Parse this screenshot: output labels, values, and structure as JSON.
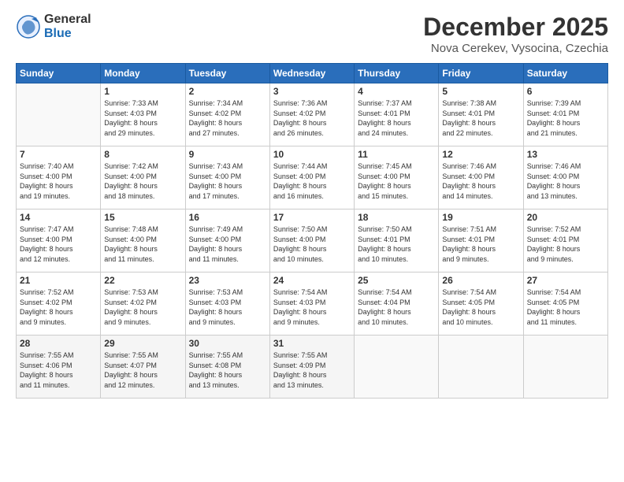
{
  "logo": {
    "general": "General",
    "blue": "Blue"
  },
  "title": "December 2025",
  "location": "Nova Cerekev, Vysocina, Czechia",
  "days_header": [
    "Sunday",
    "Monday",
    "Tuesday",
    "Wednesday",
    "Thursday",
    "Friday",
    "Saturday"
  ],
  "weeks": [
    [
      {
        "day": "",
        "info": ""
      },
      {
        "day": "1",
        "info": "Sunrise: 7:33 AM\nSunset: 4:03 PM\nDaylight: 8 hours\nand 29 minutes."
      },
      {
        "day": "2",
        "info": "Sunrise: 7:34 AM\nSunset: 4:02 PM\nDaylight: 8 hours\nand 27 minutes."
      },
      {
        "day": "3",
        "info": "Sunrise: 7:36 AM\nSunset: 4:02 PM\nDaylight: 8 hours\nand 26 minutes."
      },
      {
        "day": "4",
        "info": "Sunrise: 7:37 AM\nSunset: 4:01 PM\nDaylight: 8 hours\nand 24 minutes."
      },
      {
        "day": "5",
        "info": "Sunrise: 7:38 AM\nSunset: 4:01 PM\nDaylight: 8 hours\nand 22 minutes."
      },
      {
        "day": "6",
        "info": "Sunrise: 7:39 AM\nSunset: 4:01 PM\nDaylight: 8 hours\nand 21 minutes."
      }
    ],
    [
      {
        "day": "7",
        "info": "Sunrise: 7:40 AM\nSunset: 4:00 PM\nDaylight: 8 hours\nand 19 minutes."
      },
      {
        "day": "8",
        "info": "Sunrise: 7:42 AM\nSunset: 4:00 PM\nDaylight: 8 hours\nand 18 minutes."
      },
      {
        "day": "9",
        "info": "Sunrise: 7:43 AM\nSunset: 4:00 PM\nDaylight: 8 hours\nand 17 minutes."
      },
      {
        "day": "10",
        "info": "Sunrise: 7:44 AM\nSunset: 4:00 PM\nDaylight: 8 hours\nand 16 minutes."
      },
      {
        "day": "11",
        "info": "Sunrise: 7:45 AM\nSunset: 4:00 PM\nDaylight: 8 hours\nand 15 minutes."
      },
      {
        "day": "12",
        "info": "Sunrise: 7:46 AM\nSunset: 4:00 PM\nDaylight: 8 hours\nand 14 minutes."
      },
      {
        "day": "13",
        "info": "Sunrise: 7:46 AM\nSunset: 4:00 PM\nDaylight: 8 hours\nand 13 minutes."
      }
    ],
    [
      {
        "day": "14",
        "info": "Sunrise: 7:47 AM\nSunset: 4:00 PM\nDaylight: 8 hours\nand 12 minutes."
      },
      {
        "day": "15",
        "info": "Sunrise: 7:48 AM\nSunset: 4:00 PM\nDaylight: 8 hours\nand 11 minutes."
      },
      {
        "day": "16",
        "info": "Sunrise: 7:49 AM\nSunset: 4:00 PM\nDaylight: 8 hours\nand 11 minutes."
      },
      {
        "day": "17",
        "info": "Sunrise: 7:50 AM\nSunset: 4:00 PM\nDaylight: 8 hours\nand 10 minutes."
      },
      {
        "day": "18",
        "info": "Sunrise: 7:50 AM\nSunset: 4:01 PM\nDaylight: 8 hours\nand 10 minutes."
      },
      {
        "day": "19",
        "info": "Sunrise: 7:51 AM\nSunset: 4:01 PM\nDaylight: 8 hours\nand 9 minutes."
      },
      {
        "day": "20",
        "info": "Sunrise: 7:52 AM\nSunset: 4:01 PM\nDaylight: 8 hours\nand 9 minutes."
      }
    ],
    [
      {
        "day": "21",
        "info": "Sunrise: 7:52 AM\nSunset: 4:02 PM\nDaylight: 8 hours\nand 9 minutes."
      },
      {
        "day": "22",
        "info": "Sunrise: 7:53 AM\nSunset: 4:02 PM\nDaylight: 8 hours\nand 9 minutes."
      },
      {
        "day": "23",
        "info": "Sunrise: 7:53 AM\nSunset: 4:03 PM\nDaylight: 8 hours\nand 9 minutes."
      },
      {
        "day": "24",
        "info": "Sunrise: 7:54 AM\nSunset: 4:03 PM\nDaylight: 8 hours\nand 9 minutes."
      },
      {
        "day": "25",
        "info": "Sunrise: 7:54 AM\nSunset: 4:04 PM\nDaylight: 8 hours\nand 10 minutes."
      },
      {
        "day": "26",
        "info": "Sunrise: 7:54 AM\nSunset: 4:05 PM\nDaylight: 8 hours\nand 10 minutes."
      },
      {
        "day": "27",
        "info": "Sunrise: 7:54 AM\nSunset: 4:05 PM\nDaylight: 8 hours\nand 11 minutes."
      }
    ],
    [
      {
        "day": "28",
        "info": "Sunrise: 7:55 AM\nSunset: 4:06 PM\nDaylight: 8 hours\nand 11 minutes."
      },
      {
        "day": "29",
        "info": "Sunrise: 7:55 AM\nSunset: 4:07 PM\nDaylight: 8 hours\nand 12 minutes."
      },
      {
        "day": "30",
        "info": "Sunrise: 7:55 AM\nSunset: 4:08 PM\nDaylight: 8 hours\nand 13 minutes."
      },
      {
        "day": "31",
        "info": "Sunrise: 7:55 AM\nSunset: 4:09 PM\nDaylight: 8 hours\nand 13 minutes."
      },
      {
        "day": "",
        "info": ""
      },
      {
        "day": "",
        "info": ""
      },
      {
        "day": "",
        "info": ""
      }
    ]
  ]
}
